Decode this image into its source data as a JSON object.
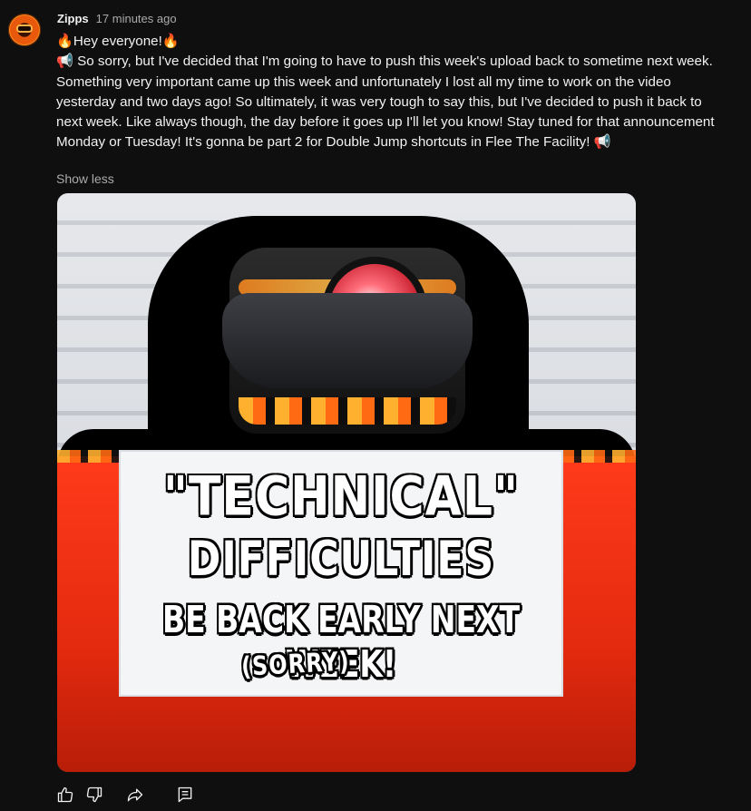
{
  "post": {
    "author": "Zipps",
    "timestamp": "17 minutes ago",
    "avatar_icon": "zipps-avatar",
    "text_line1": "🔥Hey everyone!🔥",
    "text_line2": "📢 So sorry, but I've decided that I'm going to have to push this week's upload back to sometime next week. Something very important came up this week and unfortunately I lost all my time to work on the video yesterday and two days ago! So ultimately, it was very tough to say this, but I've decided to push it back to next week. Like always though, the day before it goes up I'll let you know! Stay tuned for that announcement Monday or Tuesday! It's gonna be part 2 for Double Jump shortcuts in Flee The Facility! 📢",
    "show_less": "Show less"
  },
  "image": {
    "sign_line1": "\"TECHNICAL\"",
    "sign_line2": "DIFFICULTIES",
    "sign_line3": "BE BACK EARLY NEXT WEEK!",
    "sign_line4": "(SORRY)"
  },
  "actions": {
    "like_icon": "thumbs-up-icon",
    "dislike_icon": "thumbs-down-icon",
    "share_icon": "share-icon",
    "comment_icon": "comment-icon"
  },
  "colors": {
    "background": "#0f0f0f",
    "text_primary": "#f1f1f1",
    "text_secondary": "#aaaaaa"
  }
}
